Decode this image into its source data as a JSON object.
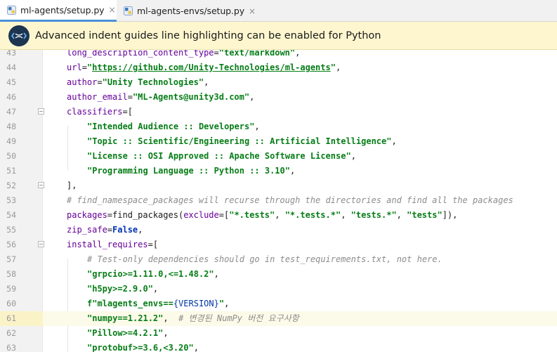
{
  "tabs": [
    {
      "label": "ml-agents/setup.py",
      "active": true,
      "close": "×"
    },
    {
      "label": "ml-agents-envs/setup.py",
      "active": false,
      "close": "×"
    }
  ],
  "banner": {
    "message": "Advanced indent guides line highlighting can be enabled for Python",
    "icon": "plugin-logo-icon"
  },
  "editor": {
    "current_line": 61,
    "lines": [
      {
        "n": "43"
      },
      {
        "n": "44"
      },
      {
        "n": "45"
      },
      {
        "n": "46"
      },
      {
        "n": "47"
      },
      {
        "n": "48"
      },
      {
        "n": "49"
      },
      {
        "n": "50"
      },
      {
        "n": "51"
      },
      {
        "n": "52"
      },
      {
        "n": "53"
      },
      {
        "n": "54"
      },
      {
        "n": "55"
      },
      {
        "n": "56"
      },
      {
        "n": "57"
      },
      {
        "n": "58"
      },
      {
        "n": "59"
      },
      {
        "n": "60"
      },
      {
        "n": "61"
      },
      {
        "n": "62"
      },
      {
        "n": "63"
      }
    ],
    "code": {
      "l43": {
        "kw": "long_description_content_type",
        "eq": "=",
        "str": "\"text/markdown\"",
        "tail": ","
      },
      "l44": {
        "kw": "url",
        "eq": "=",
        "q1": "\"",
        "url": "https://github.com/Unity-Technologies/ml-agents",
        "q2": "\"",
        "tail": ","
      },
      "l45": {
        "kw": "author",
        "eq": "=",
        "str": "\"Unity Technologies\"",
        "tail": ","
      },
      "l46": {
        "kw": "author_email",
        "eq": "=",
        "str": "\"ML-Agents@unity3d.com\"",
        "tail": ","
      },
      "l47": {
        "kw": "classifiers",
        "eq": "=",
        "tail": "["
      },
      "l48": {
        "str": "\"Intended Audience :: Developers\"",
        "tail": ","
      },
      "l49": {
        "str": "\"Topic :: Scientific/Engineering :: Artificial Intelligence\"",
        "tail": ","
      },
      "l50": {
        "str": "\"License :: OSI Approved :: Apache Software License\"",
        "tail": ","
      },
      "l51": {
        "str": "\"Programming Language :: Python :: 3.10\"",
        "tail": ","
      },
      "l52": {
        "text": "],"
      },
      "l53": {
        "comment": "# find_namespace_packages will recurse through the directories and find all the packages"
      },
      "l54": {
        "kw": "packages",
        "eq": "=",
        "fn": "find_packages(",
        "kw2": "exclude",
        "eq2": "=[",
        "s1": "\"*.tests\"",
        "c1": ", ",
        "s2": "\"*.tests.*\"",
        "c2": ", ",
        "s3": "\"tests.*\"",
        "c3": ", ",
        "s4": "\"tests\"",
        "tail": "]),"
      },
      "l55": {
        "kw": "zip_safe",
        "eq": "=",
        "kwb": "False",
        "tail": ","
      },
      "l56": {
        "kw": "install_requires",
        "eq": "=",
        "tail": "["
      },
      "l57": {
        "comment": "# Test-only dependencies should go in test_requirements.txt, not here."
      },
      "l58": {
        "str": "\"grpcio>=1.11.0,<=1.48.2\"",
        "tail": ","
      },
      "l59": {
        "str": "\"h5py>=2.9.0\"",
        "tail": ","
      },
      "l60": {
        "pre": "f\"mlagents_envs==",
        "brace": "{VERSION}",
        "post": "\"",
        "tail": ","
      },
      "l61": {
        "str": "\"numpy==1.21.2\"",
        "tail": ",  ",
        "comment": "# 변경된 NumPy 버전 요구사항"
      },
      "l62": {
        "str": "\"Pillow>=4.2.1\"",
        "tail": ","
      },
      "l63": {
        "str": "\"protobuf>=3.6,<3.20\"",
        "tail": ","
      }
    }
  },
  "colors": {
    "keyword_arg": "#660099",
    "string": "#067d17",
    "comment": "#8c8c8c",
    "banner_bg": "#fdf6cf",
    "active_tab_underline": "#4a90d9"
  }
}
